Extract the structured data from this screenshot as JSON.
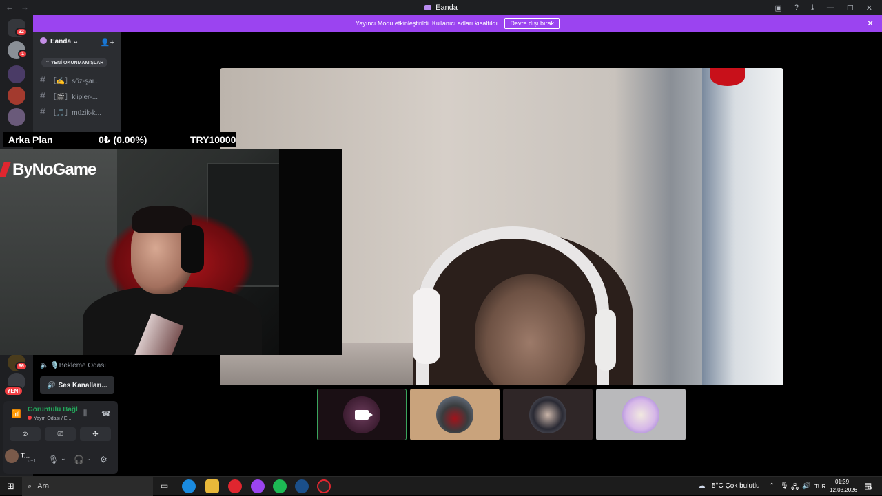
{
  "titlebar": {
    "title": "Eanda"
  },
  "banner": {
    "message": "Yayıncı Modu etkinleştirildi. Kullanıcı adları kısaltıldı.",
    "button": "Devre dışı bırak"
  },
  "rail": {
    "badges": [
      "32",
      "1",
      "96"
    ],
    "new_label": "YENİ"
  },
  "server": {
    "name": "Eanda",
    "unread_label": "YENİ OKUNMAMIŞLAR",
    "channels": [
      {
        "label": "［✍️］söz-şar..."
      },
      {
        "label": "［🎬］klipler-..."
      },
      {
        "label": "［🎵］müzik-k..."
      }
    ]
  },
  "overlay": {
    "label": "Arka Plan",
    "change": "0₺ (0.00%)",
    "goal": "TRY10000",
    "brand": "ByNoGame"
  },
  "voice_channels": {
    "waiting_room": "Bekleme Odası",
    "voice_channels_button": "Ses Kanalları..."
  },
  "voice_panel": {
    "status": "Görüntülü Bağl",
    "channel": "Yayın Odası / E..."
  },
  "user": {
    "name": "T...",
    "status": "♫+1"
  },
  "taskbar": {
    "search_placeholder": "Ara",
    "weather": "5°C  Çok bulutlu",
    "language": "TUR",
    "time": "01:39",
    "date": "12.03.2026",
    "notifications": "15"
  },
  "colors": {
    "accent": "#9b44f0",
    "green": "#23a55a",
    "red": "#f23f43"
  }
}
